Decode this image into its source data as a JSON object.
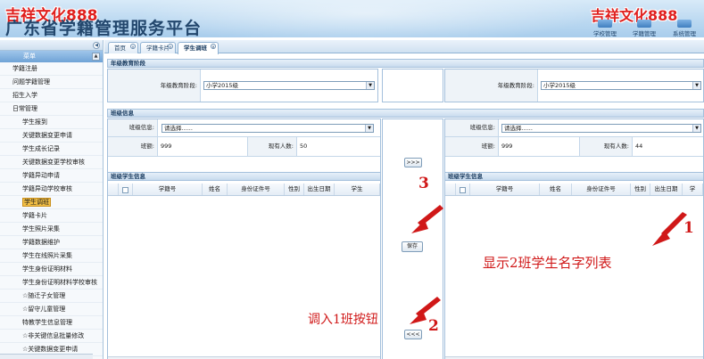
{
  "header": {
    "logo_left": "吉祥文化888",
    "logo_right": "吉祥文化888",
    "platform_title": "广东省学籍管理服务平台",
    "nav": [
      {
        "label": "学校管理",
        "icon": "school-icon"
      },
      {
        "label": "学籍管理",
        "icon": "records-icon"
      },
      {
        "label": "系统管理",
        "icon": "system-icon"
      }
    ]
  },
  "sidebar": {
    "menu_title": "菜单",
    "items": [
      {
        "label": "学籍注册",
        "level": 1
      },
      {
        "label": "问题学籍管理",
        "level": 1
      },
      {
        "label": "招生入学",
        "level": 1
      },
      {
        "label": "日常管理",
        "level": 1
      },
      {
        "label": "学生报到",
        "level": 2
      },
      {
        "label": "关键数据变更申请",
        "level": 2
      },
      {
        "label": "学生成长记录",
        "level": 2
      },
      {
        "label": "关键数据变更学校审核",
        "level": 2
      },
      {
        "label": "学籍异动申请",
        "level": 2
      },
      {
        "label": "学籍异动学校审核",
        "level": 2
      },
      {
        "label": "学生调班",
        "level": 2,
        "active": true
      },
      {
        "label": "学籍卡片",
        "level": 2
      },
      {
        "label": "学生照片采集",
        "level": 2
      },
      {
        "label": "学籍数据维护",
        "level": 2
      },
      {
        "label": "学生在线照片采集",
        "level": 2
      },
      {
        "label": "学生身份证明材料",
        "level": 2
      },
      {
        "label": "学生身份证明材料学校审核",
        "level": 2
      },
      {
        "label": "☆随迁子女管理",
        "level": 2
      },
      {
        "label": "☆留守儿童管理",
        "level": 2
      },
      {
        "label": "特教学生信息管理",
        "level": 2
      },
      {
        "label": "☆非关键信息批量修改",
        "level": 2
      },
      {
        "label": "☆关键数据变更申请",
        "level": 2
      }
    ]
  },
  "tabs": [
    {
      "label": "首页",
      "active": false
    },
    {
      "label": "学籍卡片",
      "active": false
    },
    {
      "label": "学生调班",
      "active": true
    }
  ],
  "main": {
    "section_grade": "年级教育阶段",
    "grade_label": "年级教育阶段:",
    "grade_left_value": "小学2015级",
    "grade_right_value": "小学2015级",
    "section_class": "班级信息",
    "class_info_label": "班级信息:",
    "class_left_value": "请选择......",
    "class_right_value": "请选择......",
    "class_no_label": "班额:",
    "left_class_size": "999",
    "right_class_size": "999",
    "current_count_label": "现有人数:",
    "left_current_count": "50",
    "right_current_count": "44",
    "section_students": "班级学生信息",
    "columns_left": [
      "学籍号",
      "姓名",
      "身份证件号",
      "性别",
      "出生日期",
      "学生"
    ],
    "columns_right": [
      "学籍号",
      "姓名",
      "身份证件号",
      "性别",
      "出生日期",
      "学"
    ],
    "btn_move_right": ">>>",
    "btn_save": "保存",
    "btn_move_left": "<<<"
  },
  "annotations": {
    "num1": "1",
    "num2": "2",
    "num3": "3",
    "text1": "显示2班学生名字列表",
    "text2": "调入1班按钮",
    "color": "#d01818"
  },
  "colors": {
    "header_bg": "#bcd9f1",
    "accent_red": "#e0201e",
    "active_item": "#f3c046"
  }
}
